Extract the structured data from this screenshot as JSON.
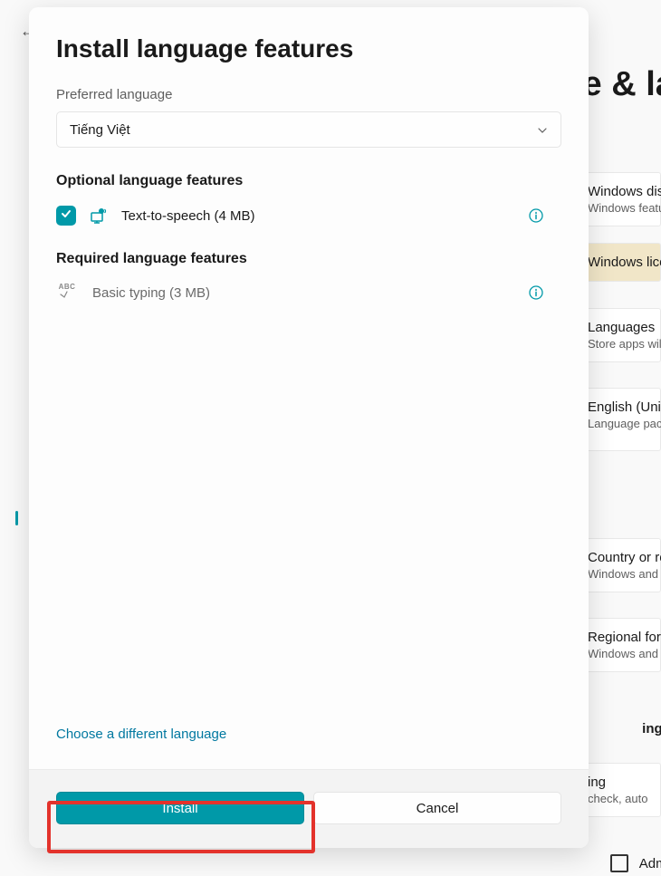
{
  "bg": {
    "title": "Time & language",
    "rows": [
      {
        "title": "Windows display",
        "sub": "Windows features"
      },
      {
        "title": "Windows license",
        "sub": ""
      },
      {
        "title": "Languages",
        "sub": "Store apps will"
      },
      {
        "title": "English (United",
        "sub": "Language pack, t"
      },
      {
        "title": "Country or region",
        "sub": "Windows and ap"
      },
      {
        "title": "Regional format",
        "sub": "Windows and so"
      },
      {
        "title": "ings",
        "sub": ""
      },
      {
        "title": "ing",
        "sub": "check, auto"
      }
    ],
    "admin": "Administrative"
  },
  "modal": {
    "title": "Install language features",
    "preferred_label": "Preferred language",
    "language_selected": "Tiếng Việt",
    "optional_heading": "Optional language features",
    "tts_label": "Text-to-speech (4 MB)",
    "required_heading": "Required language features",
    "basic_typing_label": "Basic typing (3 MB)",
    "choose_link": "Choose a different language",
    "install_btn": "Install",
    "cancel_btn": "Cancel"
  }
}
